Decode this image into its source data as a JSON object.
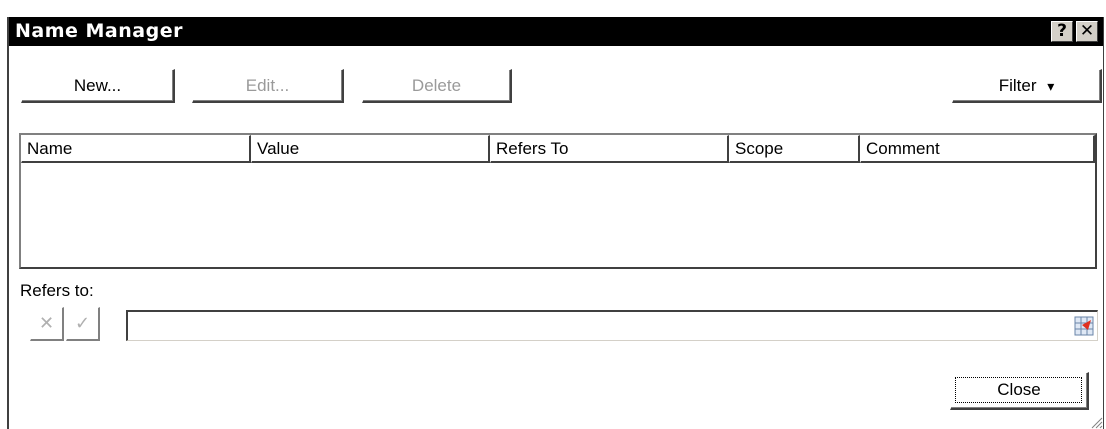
{
  "window": {
    "title": "Name Manager",
    "help_label": "?",
    "close_glyph": "✕"
  },
  "toolbar": {
    "new_label": "New...",
    "edit_label": "Edit...",
    "delete_label": "Delete",
    "filter_label": "Filter",
    "filter_arrow": "▾"
  },
  "list": {
    "columns": [
      "Name",
      "Value",
      "Refers To",
      "Scope",
      "Comment"
    ]
  },
  "refers_to": {
    "label": "Refers to:",
    "value": "",
    "cancel_glyph": "✕",
    "confirm_glyph": "✓"
  },
  "footer": {
    "close_label": "Close"
  },
  "icons": {
    "collapse": "range-selector-icon"
  },
  "colors": {
    "titlebar": "#000000",
    "face": "#ffffff",
    "shadow": "#404040",
    "disabled_text": "#9a9a9a"
  }
}
